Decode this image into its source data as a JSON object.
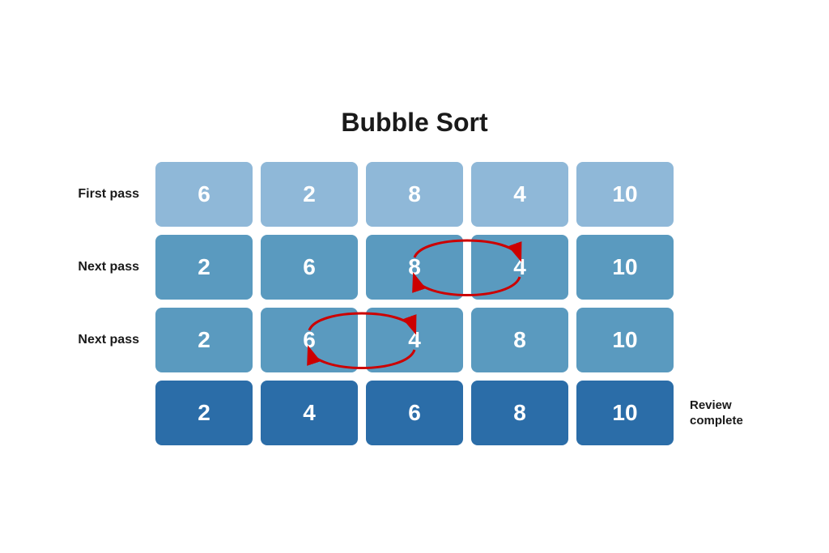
{
  "title": "Bubble Sort",
  "rows": [
    {
      "label": "First pass",
      "label_position": "left",
      "cells": [
        {
          "value": "6",
          "shade": "light"
        },
        {
          "value": "2",
          "shade": "light"
        },
        {
          "value": "8",
          "shade": "light"
        },
        {
          "value": "4",
          "shade": "light"
        },
        {
          "value": "10",
          "shade": "light"
        }
      ],
      "arrows": null
    },
    {
      "label": "Next pass",
      "label_position": "left",
      "cells": [
        {
          "value": "2",
          "shade": "medium"
        },
        {
          "value": "6",
          "shade": "medium"
        },
        {
          "value": "8",
          "shade": "medium"
        },
        {
          "value": "4",
          "shade": "medium"
        },
        {
          "value": "10",
          "shade": "medium"
        }
      ],
      "arrows": {
        "between": [
          2,
          3
        ]
      }
    },
    {
      "label": "Next pass",
      "label_position": "left",
      "cells": [
        {
          "value": "2",
          "shade": "medium"
        },
        {
          "value": "6",
          "shade": "medium"
        },
        {
          "value": "4",
          "shade": "medium"
        },
        {
          "value": "8",
          "shade": "medium"
        },
        {
          "value": "10",
          "shade": "medium"
        }
      ],
      "arrows": {
        "between": [
          1,
          2
        ]
      }
    },
    {
      "label": "Review complete",
      "label_position": "right",
      "cells": [
        {
          "value": "2",
          "shade": "dark"
        },
        {
          "value": "4",
          "shade": "dark"
        },
        {
          "value": "6",
          "shade": "dark"
        },
        {
          "value": "8",
          "shade": "dark"
        },
        {
          "value": "10",
          "shade": "dark"
        }
      ],
      "arrows": null
    }
  ]
}
